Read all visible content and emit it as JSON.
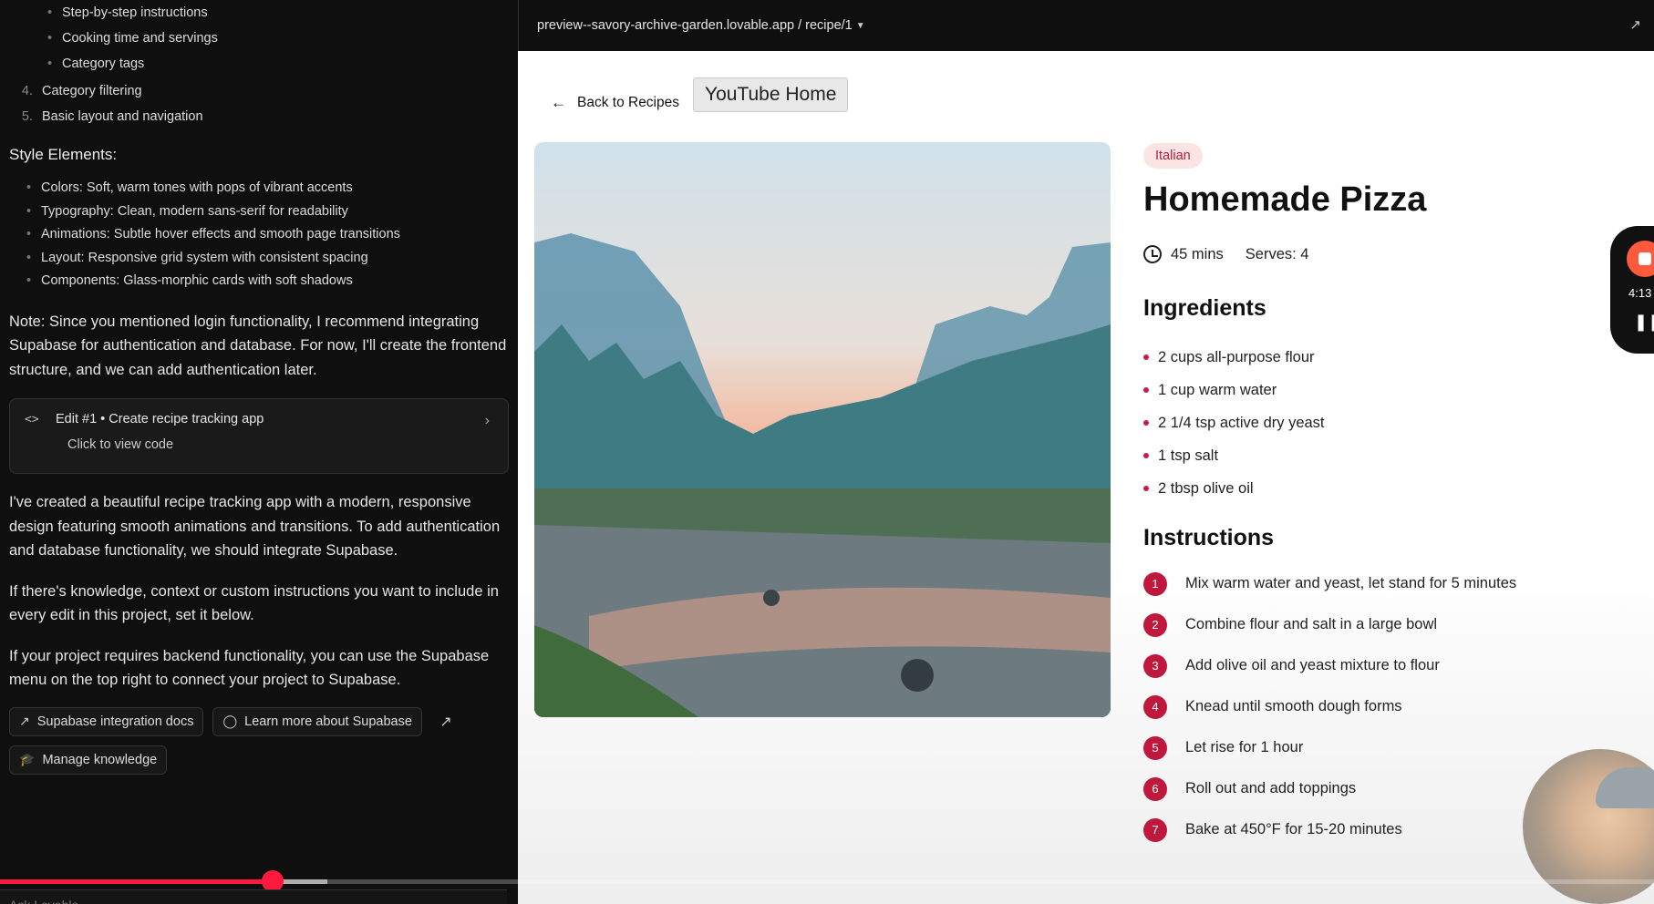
{
  "chat": {
    "sub_bullets": [
      "Step-by-step instructions",
      "Cooking time and servings",
      "Category tags"
    ],
    "numbered": [
      {
        "n": "4.",
        "text": "Category filtering"
      },
      {
        "n": "5.",
        "text": "Basic layout and navigation"
      }
    ],
    "style_heading": "Style Elements:",
    "style_items": [
      "Colors: Soft, warm tones with pops of vibrant accents",
      "Typography: Clean, modern sans-serif for readability",
      "Animations: Subtle hover effects and smooth page transitions",
      "Layout: Responsive grid system with consistent spacing",
      "Components: Glass-morphic cards with soft shadows"
    ],
    "note": "Note: Since you mentioned login functionality, I recommend integrating Supabase for authentication and database. For now, I'll create the frontend structure, and we can add authentication later.",
    "edit_card": {
      "title": "Edit #1 • Create recipe tracking app",
      "sub": "Click to view code"
    },
    "para1": "I've created a beautiful recipe tracking app with a modern, responsive design featuring smooth animations and transitions. To add authentication and database functionality, we should integrate Supabase.",
    "para2": "If there's knowledge, context or custom instructions you want to include in every edit in this project, set it below.",
    "para3": "If your project requires backend functionality, you can use the Supabase menu on the top right to connect your project to Supabase.",
    "chips": {
      "docs": "Supabase integration docs",
      "learn": "Learn more about Supabase",
      "knowledge": "Manage knowledge"
    },
    "input_placeholder": "Ask Lovable..."
  },
  "preview": {
    "url": "preview--savory-archive-garden.lovable.app / recipe/1",
    "back_label": "Back to Recipes",
    "tooltip": "YouTube Home",
    "tag": "Italian",
    "title": "Homemade Pizza",
    "time": "45 mins",
    "serves": "Serves: 4",
    "ingredients_heading": "Ingredients",
    "ingredients": [
      "2 cups all-purpose flour",
      "1 cup warm water",
      "2 1/4 tsp active dry yeast",
      "1 tsp salt",
      "2 tbsp olive oil"
    ],
    "instructions_heading": "Instructions",
    "steps": [
      {
        "n": "1",
        "text": "Mix warm water and yeast, let stand for 5 minutes"
      },
      {
        "n": "2",
        "text": "Combine flour and salt in a large bowl"
      },
      {
        "n": "3",
        "text": "Add olive oil and yeast mixture to flour"
      },
      {
        "n": "4",
        "text": "Knead until smooth dough forms"
      },
      {
        "n": "5",
        "text": "Let rise for 1 hour"
      },
      {
        "n": "6",
        "text": "Roll out and add toppings"
      },
      {
        "n": "7",
        "text": "Bake at 450°F for 15-20 minutes"
      }
    ]
  },
  "recorder": {
    "time": "4:13"
  },
  "video": {
    "progress_fraction": 0.165
  },
  "colors": {
    "accent": "#c0183c",
    "progress": "#ff1a3d",
    "tag_bg": "#fde4e4"
  }
}
